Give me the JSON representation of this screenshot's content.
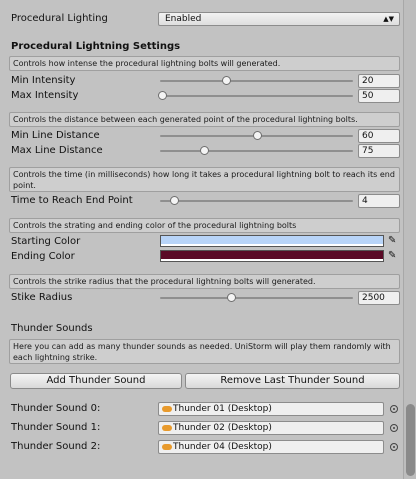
{
  "procedural_lighting": {
    "label": "Procedural Lighting",
    "value": "Enabled"
  },
  "settings_header": "Procedural Lightning Settings",
  "help": {
    "intensity": "Controls how intense the procedural lightning bolts will generated.",
    "distance": "Controls the distance between each generated point of the procedural lightning bolts.",
    "time": "Controls the time (in milliseconds) how long it takes a procedural lightning bolt to reach its end point.",
    "color": "Controls the strating and ending color of the procedural lightning bolts",
    "radius": "Controls the strike radius that the procedural lightning bolts will generated.",
    "thunder": "Here you can add as many thunder sounds as needed. UniStorm will play them randomly with each lightning strike."
  },
  "sliders": {
    "min_intensity": {
      "label": "Min Intensity",
      "value": "20",
      "fraction": 0.34
    },
    "max_intensity": {
      "label": "Max Intensity",
      "value": "50",
      "fraction": 0.01
    },
    "min_line_distance": {
      "label": "Min Line Distance",
      "value": "60",
      "fraction": 0.5
    },
    "max_line_distance": {
      "label": "Max Line Distance",
      "value": "75",
      "fraction": 0.23
    },
    "time_to_end": {
      "label": "Time to Reach End Point",
      "value": "4",
      "fraction": 0.07
    },
    "strike_radius": {
      "label": "Stike Radius",
      "value": "2500",
      "fraction": 0.37
    }
  },
  "colors": {
    "starting": {
      "label": "Starting Color",
      "hex": "#b8d4f8"
    },
    "ending": {
      "label": "Ending Color",
      "hex": "#5a0a26"
    }
  },
  "thunder": {
    "header": "Thunder Sounds",
    "add_button": "Add Thunder Sound",
    "remove_button": "Remove Last Thunder Sound",
    "sounds": [
      {
        "label": "Thunder Sound 0:",
        "value": "Thunder 01 (Desktop)"
      },
      {
        "label": "Thunder Sound 1:",
        "value": "Thunder 02 (Desktop)"
      },
      {
        "label": "Thunder Sound 2:",
        "value": "Thunder 04 (Desktop)"
      }
    ]
  }
}
